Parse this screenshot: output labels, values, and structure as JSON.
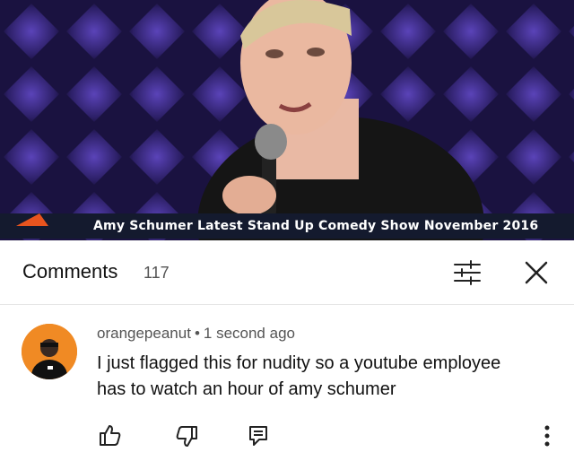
{
  "video": {
    "caption": "Amy Schumer Latest Stand Up Comedy Show November 2016",
    "colors": {
      "backdrop": "#2a1f5e",
      "caption_bar": "#141a2e",
      "accent": "#e8541e"
    }
  },
  "comments_header": {
    "title": "Comments",
    "count": "117",
    "sort_icon": "sort-filter-icon",
    "close_icon": "close-icon"
  },
  "comment": {
    "author": "orangepeanut",
    "separator": "•",
    "time": "1 second ago",
    "text_lines": [
      "I just flagged this for nudity so a youtube employee",
      "has to watch an hour of amy schumer"
    ],
    "actions": [
      "like-icon",
      "dislike-icon",
      "reply-icon",
      "more-icon"
    ]
  }
}
